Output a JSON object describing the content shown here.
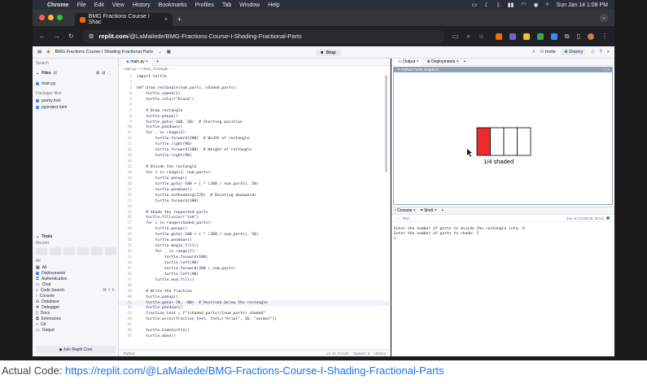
{
  "menubar": {
    "app": "Chrome",
    "items": [
      "File",
      "Edit",
      "View",
      "History",
      "Bookmarks",
      "Profiles",
      "Tab",
      "Window",
      "Help"
    ],
    "clock": "Sun Jan 14  1:08 PM"
  },
  "browser": {
    "tab_title": "BMG Fractions Course I Shac",
    "url_host": "replit.com",
    "url_path": "/@LaMailede/BMG-Fractions-Course-I-Shading-Fractional-Parts"
  },
  "replit": {
    "repl_name": "BMG Fractions Course I Shading Fractional Parts",
    "stop_label": "Stop",
    "invite_label": "Invite",
    "deploy_label": "Deploy"
  },
  "sidebar": {
    "search_label": "Search",
    "files_label": "Files",
    "files": [
      "main.py"
    ],
    "packager_label": "Packager files",
    "packager_files": [
      "poetry.lock",
      "pyproject.toml"
    ],
    "tools_label": "Tools",
    "tools_sub": "Recent",
    "all_label": "All",
    "tools": [
      "Deployments",
      "Authentication",
      "Chat",
      "Code Search",
      "Console",
      "Database",
      "Debugger",
      "Docs",
      "Extensions",
      "Git",
      "Output"
    ],
    "code_search_shortcut": "⌘ ⇧ F",
    "join_core": "Join Replit Core"
  },
  "editor": {
    "tab": "main.py",
    "crumb": "main.py  ›  ƒ draw_rectangle  ›  ...",
    "lines": [
      "import turtle",
      "",
      "def draw_rectangle(num_parts, shaded_parts):",
      "    turtle.speed(1)",
      "    turtle.color(\"black\")",
      "",
      "    # Draw rectangle",
      "    turtle.penup()",
      "    turtle.goto(-100, 50)  # Starting position",
      "    turtle.pendown()",
      "    for _ in range(2):",
      "        turtle.forward(200)  # Width of rectangle",
      "        turtle.right(90)",
      "        turtle.forward(100)  # Height of rectangle",
      "        turtle.right(90)",
      "",
      "    # Divide the rectangle",
      "    for i in range(1, num_parts):",
      "        turtle.penup()",
      "        turtle.goto(-100 + i * (200 / num_parts), 50)",
      "        turtle.pendown()",
      "        turtle.setheading(270)  # Pointing downwards",
      "        turtle.forward(100)",
      "",
      "    # Shade the requested parts",
      "    turtle.fillcolor(\"red\")",
      "    for i in range(shaded_parts):",
      "        turtle.penup()",
      "        turtle.goto(-100 + i * (200 / num_parts), 50)",
      "        turtle.pendown()",
      "        turtle.begin_fill()",
      "        for _ in range(2):",
      "            turtle.forward(100)",
      "            turtle.left(90)",
      "            turtle.forward(200 / num_parts)",
      "            turtle.left(90)",
      "        turtle.end_fill()",
      "",
      "    # Write the fraction",
      "    turtle.penup()",
      "    turtle.goto(-70, -80)  # Position below the rectangle",
      "    turtle.pendown()",
      "    fraction_text = f\"{shaded_parts}/{num_parts} shaded\"",
      "    turtle.write(fraction_text, font=(\"Arial\", 16, \"normal\"))",
      "",
      "    turtle.hideturtle()",
      "    turtle.done()"
    ],
    "highlight_line": 41,
    "status_left": "Python",
    "status_pos": "Ln 41, Col 29",
    "status_spaces": "Spaces: 2",
    "status_history": "History"
  },
  "output": {
    "tab_output": "Output",
    "tab_deployments": "Deployments",
    "window_title": "Python Turtle Graphics",
    "fraction_label": "1/4 shaded",
    "num_parts": 4,
    "shaded_parts": 1,
    "shade_color": "#ee2b2b"
  },
  "console": {
    "tab_console": "Console",
    "tab_shell": "Shell",
    "run_label": "Run",
    "run_status": "24s on 13:08:03, 01/14",
    "lines": [
      "Enter the number of parts to divide the rectangle into: 4",
      "Enter the number of parts to shade: 1"
    ],
    "cursor": "▯"
  },
  "caption": {
    "prefix": "Actual Code: ",
    "link": "https://replit.com/@LaMailede/BMG-Fractions-Course-I-Shading-Fractional-Parts"
  }
}
